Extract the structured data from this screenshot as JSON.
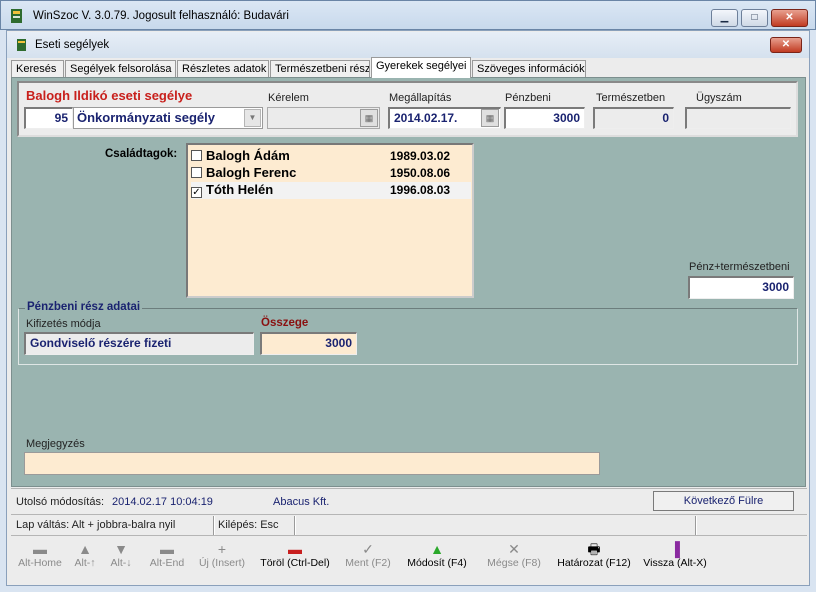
{
  "window": {
    "title": "WinSzoc V. 3.0.79. Jogosult felhasználó: Budavári",
    "min": "▁",
    "max": "□",
    "close": "✕"
  },
  "child": {
    "title": "Eseti segélyek",
    "close": "✕"
  },
  "tabs": [
    "Keresés",
    "Segélyek felsorolása",
    "Részletes adatok",
    "Természetbeni rész",
    "Gyerekek segélyei",
    "Szöveges információk"
  ],
  "header": {
    "title": "Balogh Ildikó eseti segélye",
    "kerelem_label": "Kérelem",
    "megall_label": "Megállapítás",
    "penzbeni_label": "Pénzbeni",
    "termesz_label": "Természetben",
    "ugyszam_label": "Ügyszám",
    "code": "95",
    "type": "Önkormányzati segély",
    "kerelem": "",
    "megall": "2014.02.17.",
    "penzbeni": "3000",
    "termesz": "0",
    "ugyszam": ""
  },
  "family": {
    "label": "Családtagok:",
    "members": [
      {
        "name": "Balogh Ádám",
        "date": "1989.03.02",
        "checked": ""
      },
      {
        "name": "Balogh Ferenc",
        "date": "1950.08.06",
        "checked": ""
      },
      {
        "name": "Tóth Helén",
        "date": "1996.08.03",
        "checked": "✓"
      }
    ]
  },
  "total": {
    "label": "Pénz+természetbeni",
    "value": "3000"
  },
  "money": {
    "group_label": "Pénzbeni rész adatai",
    "method_label": "Kifizetés módja",
    "method": "Gondviselő részére fizeti",
    "amount_label": "Összege",
    "amount": "3000"
  },
  "note": {
    "label": "Megjegyzés",
    "value": ""
  },
  "lastmod": {
    "label": "Utolsó módosítás:",
    "datetime": "2014.02.17 10:04:19",
    "company": "Abacus Kft.",
    "next_btn": "Következő Fülre"
  },
  "status": {
    "hint": "Lap váltás: Alt + jobbra-balra nyil",
    "exit": "Kilépés: Esc"
  },
  "toolbar": [
    {
      "icon": "▬",
      "label": "Alt-Home"
    },
    {
      "icon": "▲",
      "label": "Alt-↑"
    },
    {
      "icon": "▼",
      "label": "Alt-↓"
    },
    {
      "icon": "▬",
      "label": "Alt-End"
    },
    {
      "icon": "+",
      "label": "Új (Insert)"
    },
    {
      "icon": "▬",
      "label": "Töröl (Ctrl-Del)"
    },
    {
      "icon": "✓",
      "label": "Ment (F2)"
    },
    {
      "icon": "▲",
      "label": "Módosít (F4)"
    },
    {
      "icon": "✕",
      "label": "Mégse (F8)"
    },
    {
      "icon": "🖶",
      "label": "Határozat (F12)"
    },
    {
      "icon": "▐",
      "label": "Vissza (Alt-X)"
    }
  ]
}
